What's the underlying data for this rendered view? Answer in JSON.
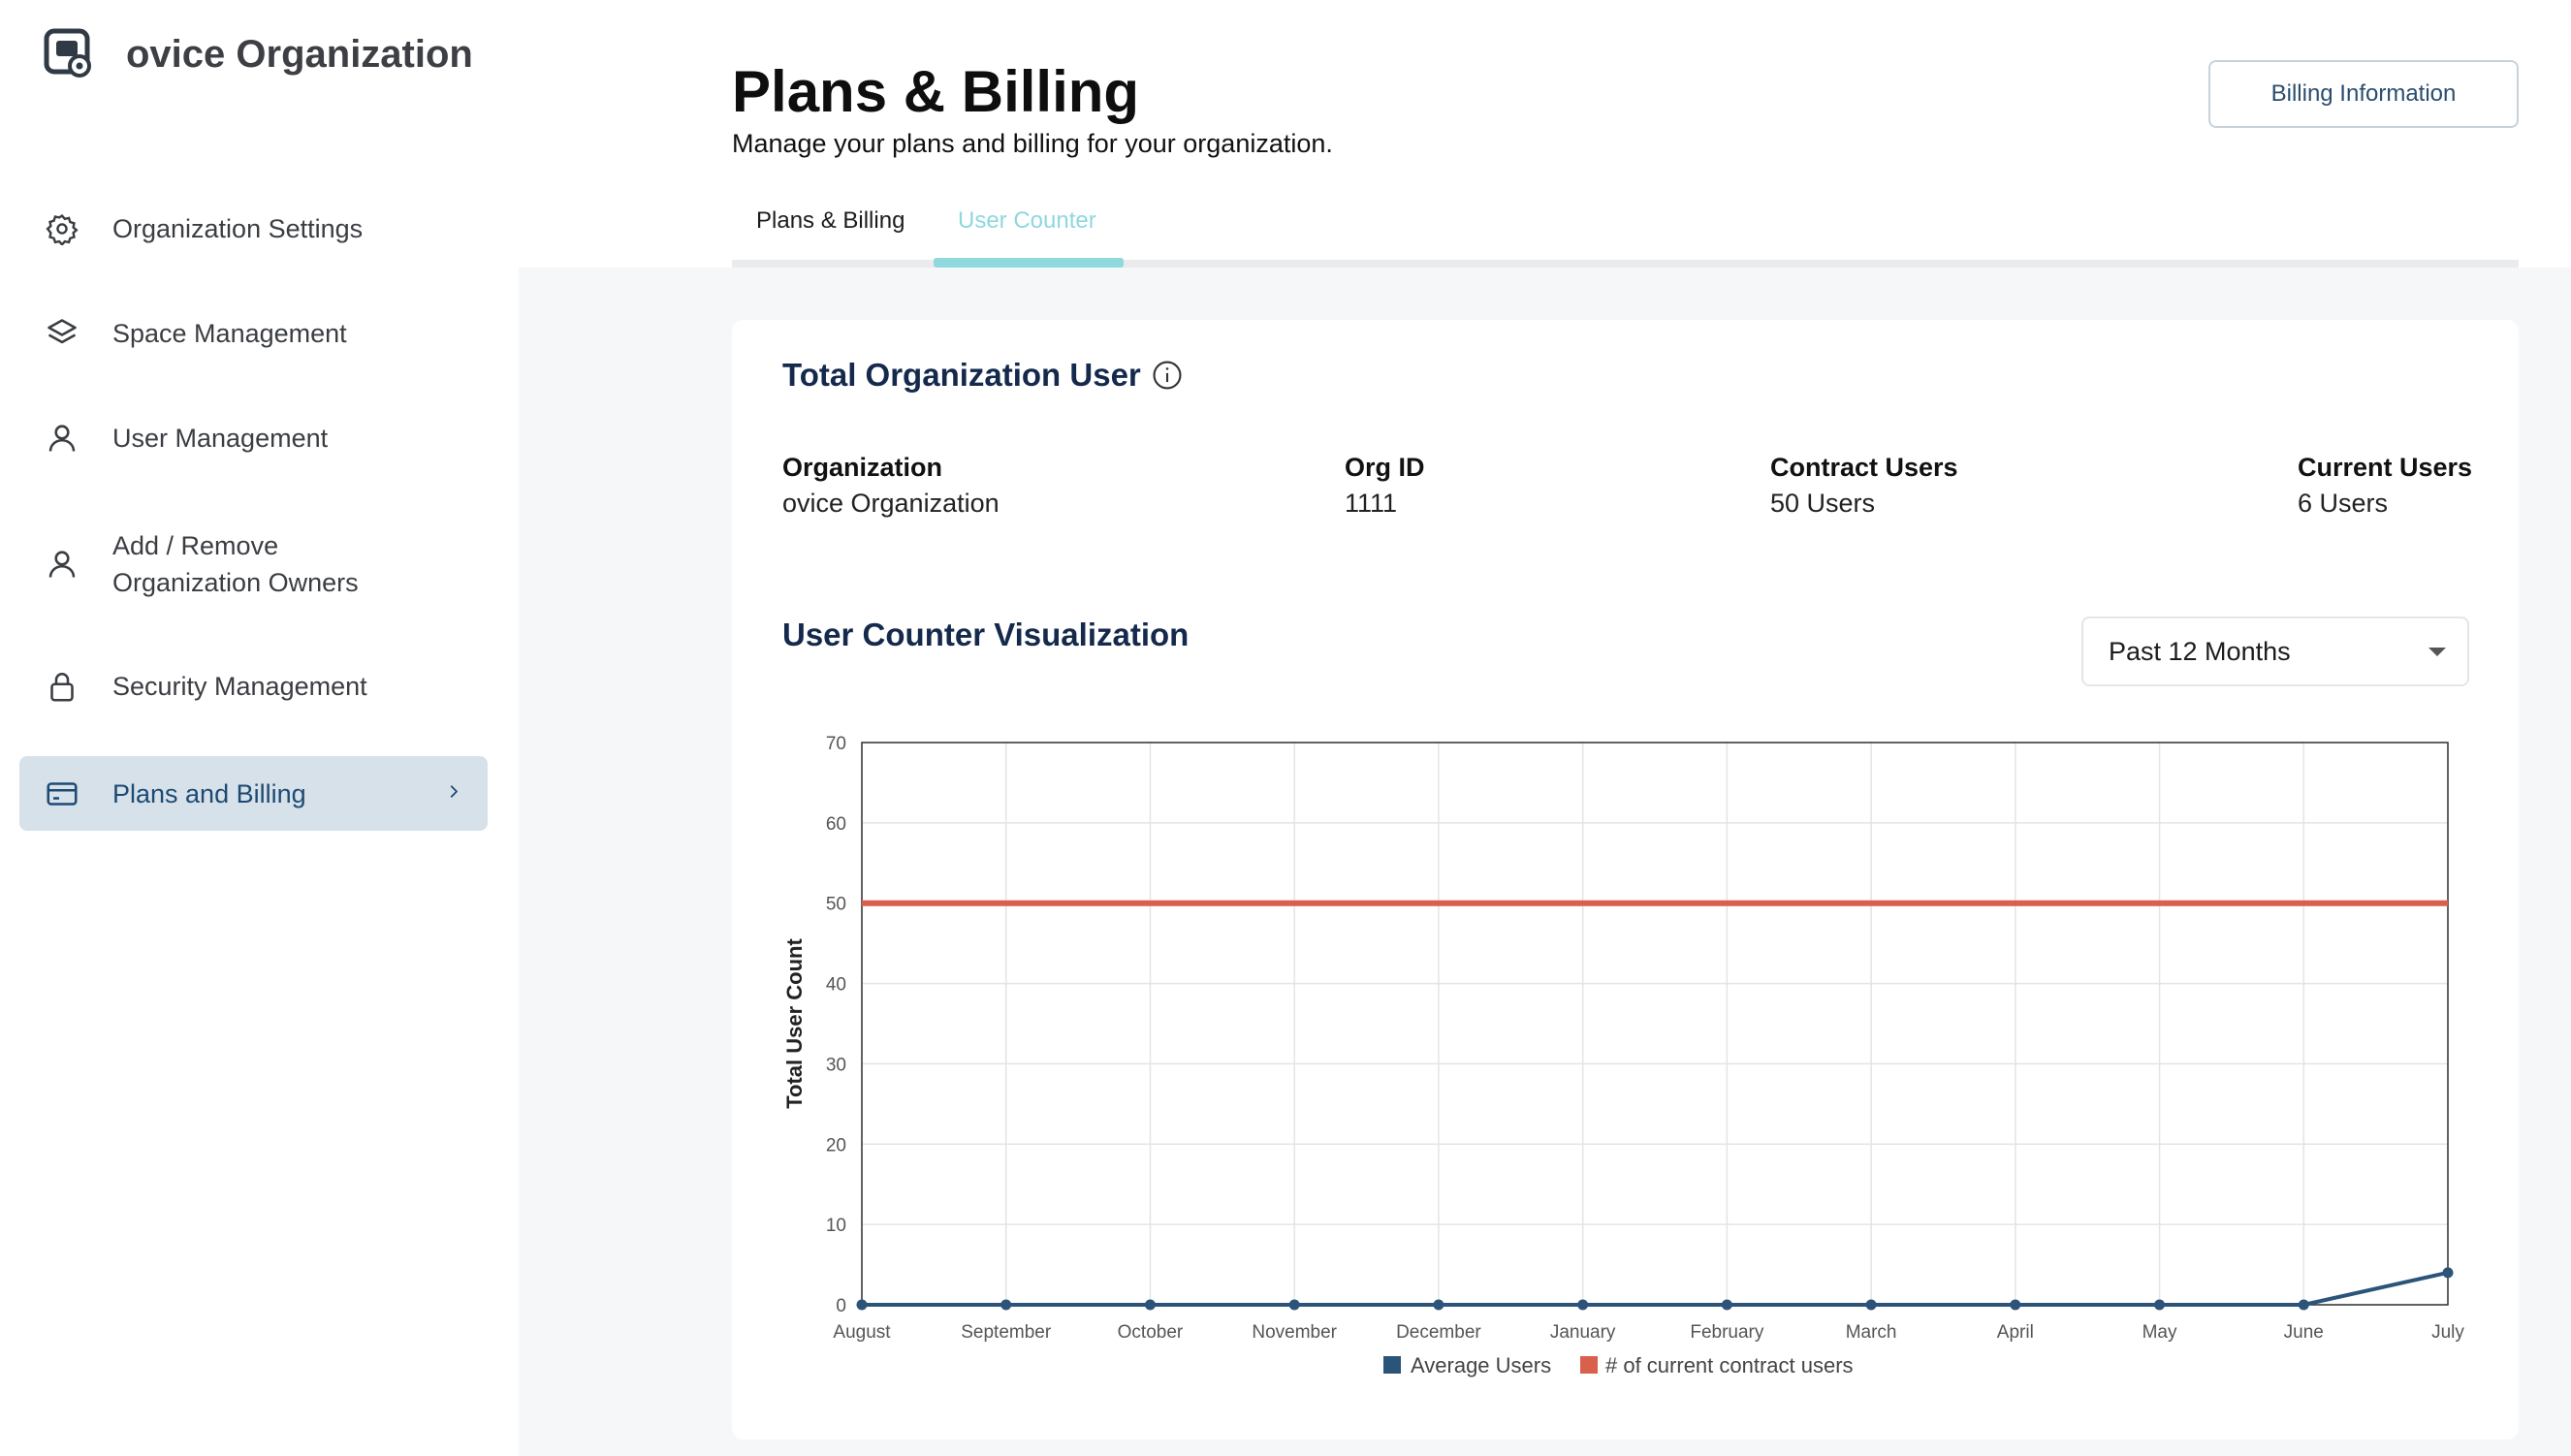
{
  "sidebar": {
    "org_name": "ovice Organization",
    "items": [
      {
        "label": "Organization Settings",
        "icon": "gear-icon"
      },
      {
        "label": "Space Management",
        "icon": "layers-icon"
      },
      {
        "label": "User Management",
        "icon": "user-icon"
      },
      {
        "label": "Add / Remove\nOrganization Owners",
        "icon": "user-icon"
      },
      {
        "label": "Security Management",
        "icon": "lock-icon"
      },
      {
        "label": "Plans and Billing",
        "icon": "credit-card-icon",
        "active": true
      }
    ]
  },
  "header": {
    "title": "Plans & Billing",
    "subtitle": "Manage your plans and billing for your organization.",
    "billing_button": "Billing Information"
  },
  "tabs": [
    {
      "label": "Plans & Billing",
      "active": false
    },
    {
      "label": "User Counter",
      "active": true
    }
  ],
  "card": {
    "title": "Total Organization User",
    "stats": [
      {
        "key": "Organization",
        "value": "ovice Organization"
      },
      {
        "key": "Org ID",
        "value": "1111"
      },
      {
        "key": "Contract Users",
        "value": "50 Users"
      },
      {
        "key": "Current Users",
        "value": "6 Users"
      }
    ],
    "viz_title": "User Counter Visualization",
    "range_select": "Past 12 Months"
  },
  "colors": {
    "accent_tab": "#8fd8de",
    "series_avg": "#2c5479",
    "series_contract": "#d9604a",
    "sidebar_active": "#d6e1ea"
  },
  "chart_data": {
    "type": "line",
    "title": "",
    "xlabel": "",
    "ylabel": "Total User Count",
    "categories": [
      "August",
      "September",
      "October",
      "November",
      "December",
      "January",
      "February",
      "March",
      "April",
      "May",
      "June",
      "July"
    ],
    "ylim": [
      0,
      70
    ],
    "yticks": [
      0,
      10,
      20,
      30,
      40,
      50,
      60,
      70
    ],
    "grid": true,
    "legend_position": "bottom",
    "series": [
      {
        "name": "Average Users",
        "values": [
          0,
          0,
          0,
          0,
          0,
          0,
          0,
          0,
          0,
          0,
          0,
          4
        ],
        "color": "#2c5479",
        "markers": true
      },
      {
        "name": "# of current contract users",
        "values": [
          50,
          50,
          50,
          50,
          50,
          50,
          50,
          50,
          50,
          50,
          50,
          50
        ],
        "color": "#d9604a",
        "markers": false
      }
    ]
  }
}
